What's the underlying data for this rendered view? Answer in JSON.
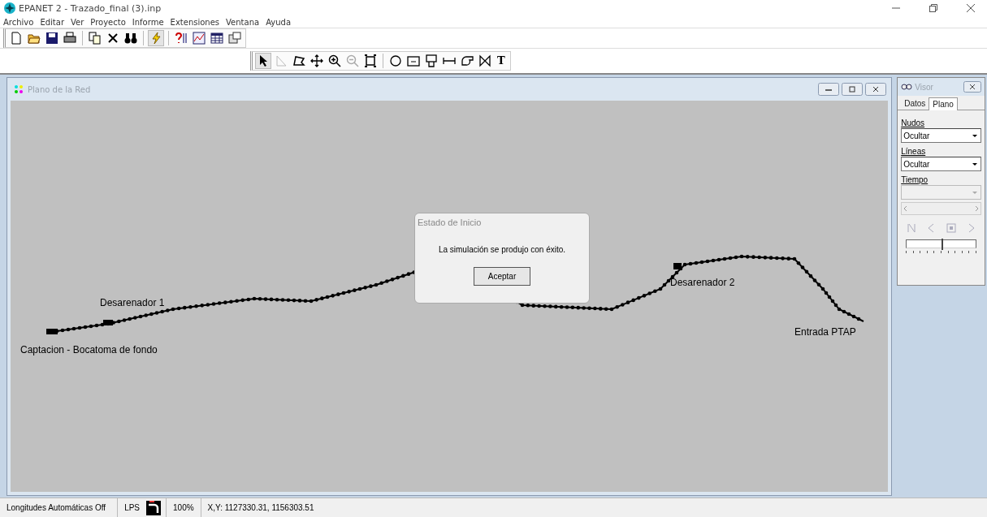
{
  "window": {
    "title": "EPANET 2 - Trazado_final (3).inp"
  },
  "menu": [
    "Archivo",
    "Editar",
    "Ver",
    "Proyecto",
    "Informe",
    "Extensiones",
    "Ventana",
    "Ayuda"
  ],
  "map_window": {
    "title": "Plano de la Red",
    "labels": [
      "Desarenador 1",
      "Captacion - Bocatoma de fondo",
      "Desarenador 2",
      "Entrada PTAP"
    ]
  },
  "dialog": {
    "title": "Estado de Inicio",
    "message": "La simulación se produjo con éxito.",
    "button": "Aceptar"
  },
  "visor": {
    "title": "Visor",
    "tabs": [
      {
        "label": "Datos",
        "selected": false
      },
      {
        "label": "Plano",
        "selected": true
      }
    ],
    "nodes_label": "Nudos",
    "nodes_value": "Ocultar",
    "links_label": "Líneas",
    "links_value": "Ocultar",
    "time_label": "Tiempo",
    "speed": {
      "level": 0.5
    }
  },
  "toolbar2_text_tool": "T",
  "status_bar": [
    "Longitudes Automáticas Off",
    "LPS",
    "100%",
    "X,Y: 1127330.31, 1156303.51"
  ]
}
